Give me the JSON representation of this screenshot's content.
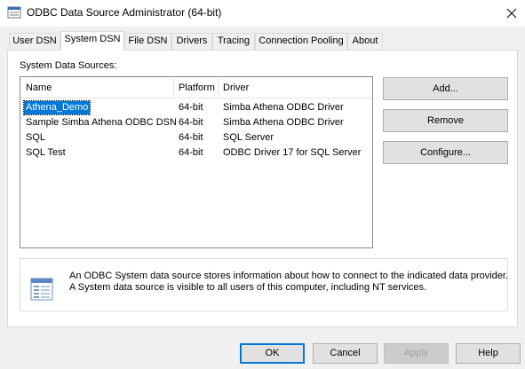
{
  "window": {
    "title": "ODBC Data Source Administrator (64-bit)",
    "close_glyph": "✕"
  },
  "tabs": [
    {
      "label": "User DSN"
    },
    {
      "label": "System DSN",
      "active": true
    },
    {
      "label": "File DSN"
    },
    {
      "label": "Drivers"
    },
    {
      "label": "Tracing"
    },
    {
      "label": "Connection Pooling"
    },
    {
      "label": "About"
    }
  ],
  "main": {
    "section_label": "System Data Sources:",
    "columns": [
      "Name",
      "Platform",
      "Driver"
    ],
    "rows": [
      {
        "name": "Athena_Demo",
        "platform": "64-bit",
        "driver": "Simba Athena ODBC Driver",
        "selected": true
      },
      {
        "name": "Sample Simba Athena ODBC DSN",
        "platform": "64-bit",
        "driver": "Simba Athena ODBC Driver"
      },
      {
        "name": "SQL",
        "platform": "64-bit",
        "driver": "SQL Server"
      },
      {
        "name": "SQL Test",
        "platform": "64-bit",
        "driver": "ODBC Driver 17 for SQL Server"
      }
    ],
    "side_buttons": {
      "add": "Add...",
      "remove": "Remove",
      "configure": "Configure..."
    },
    "description": {
      "line1": "An ODBC System data source stores information about how to connect to the indicated data provider.",
      "line2": "A System data source is visible to all users of this computer, including NT services."
    }
  },
  "footer": {
    "ok": "OK",
    "cancel": "Cancel",
    "apply": "Apply",
    "help": "Help"
  },
  "colors": {
    "selection": "#0078d7",
    "default_button_border": "#0078d7"
  }
}
